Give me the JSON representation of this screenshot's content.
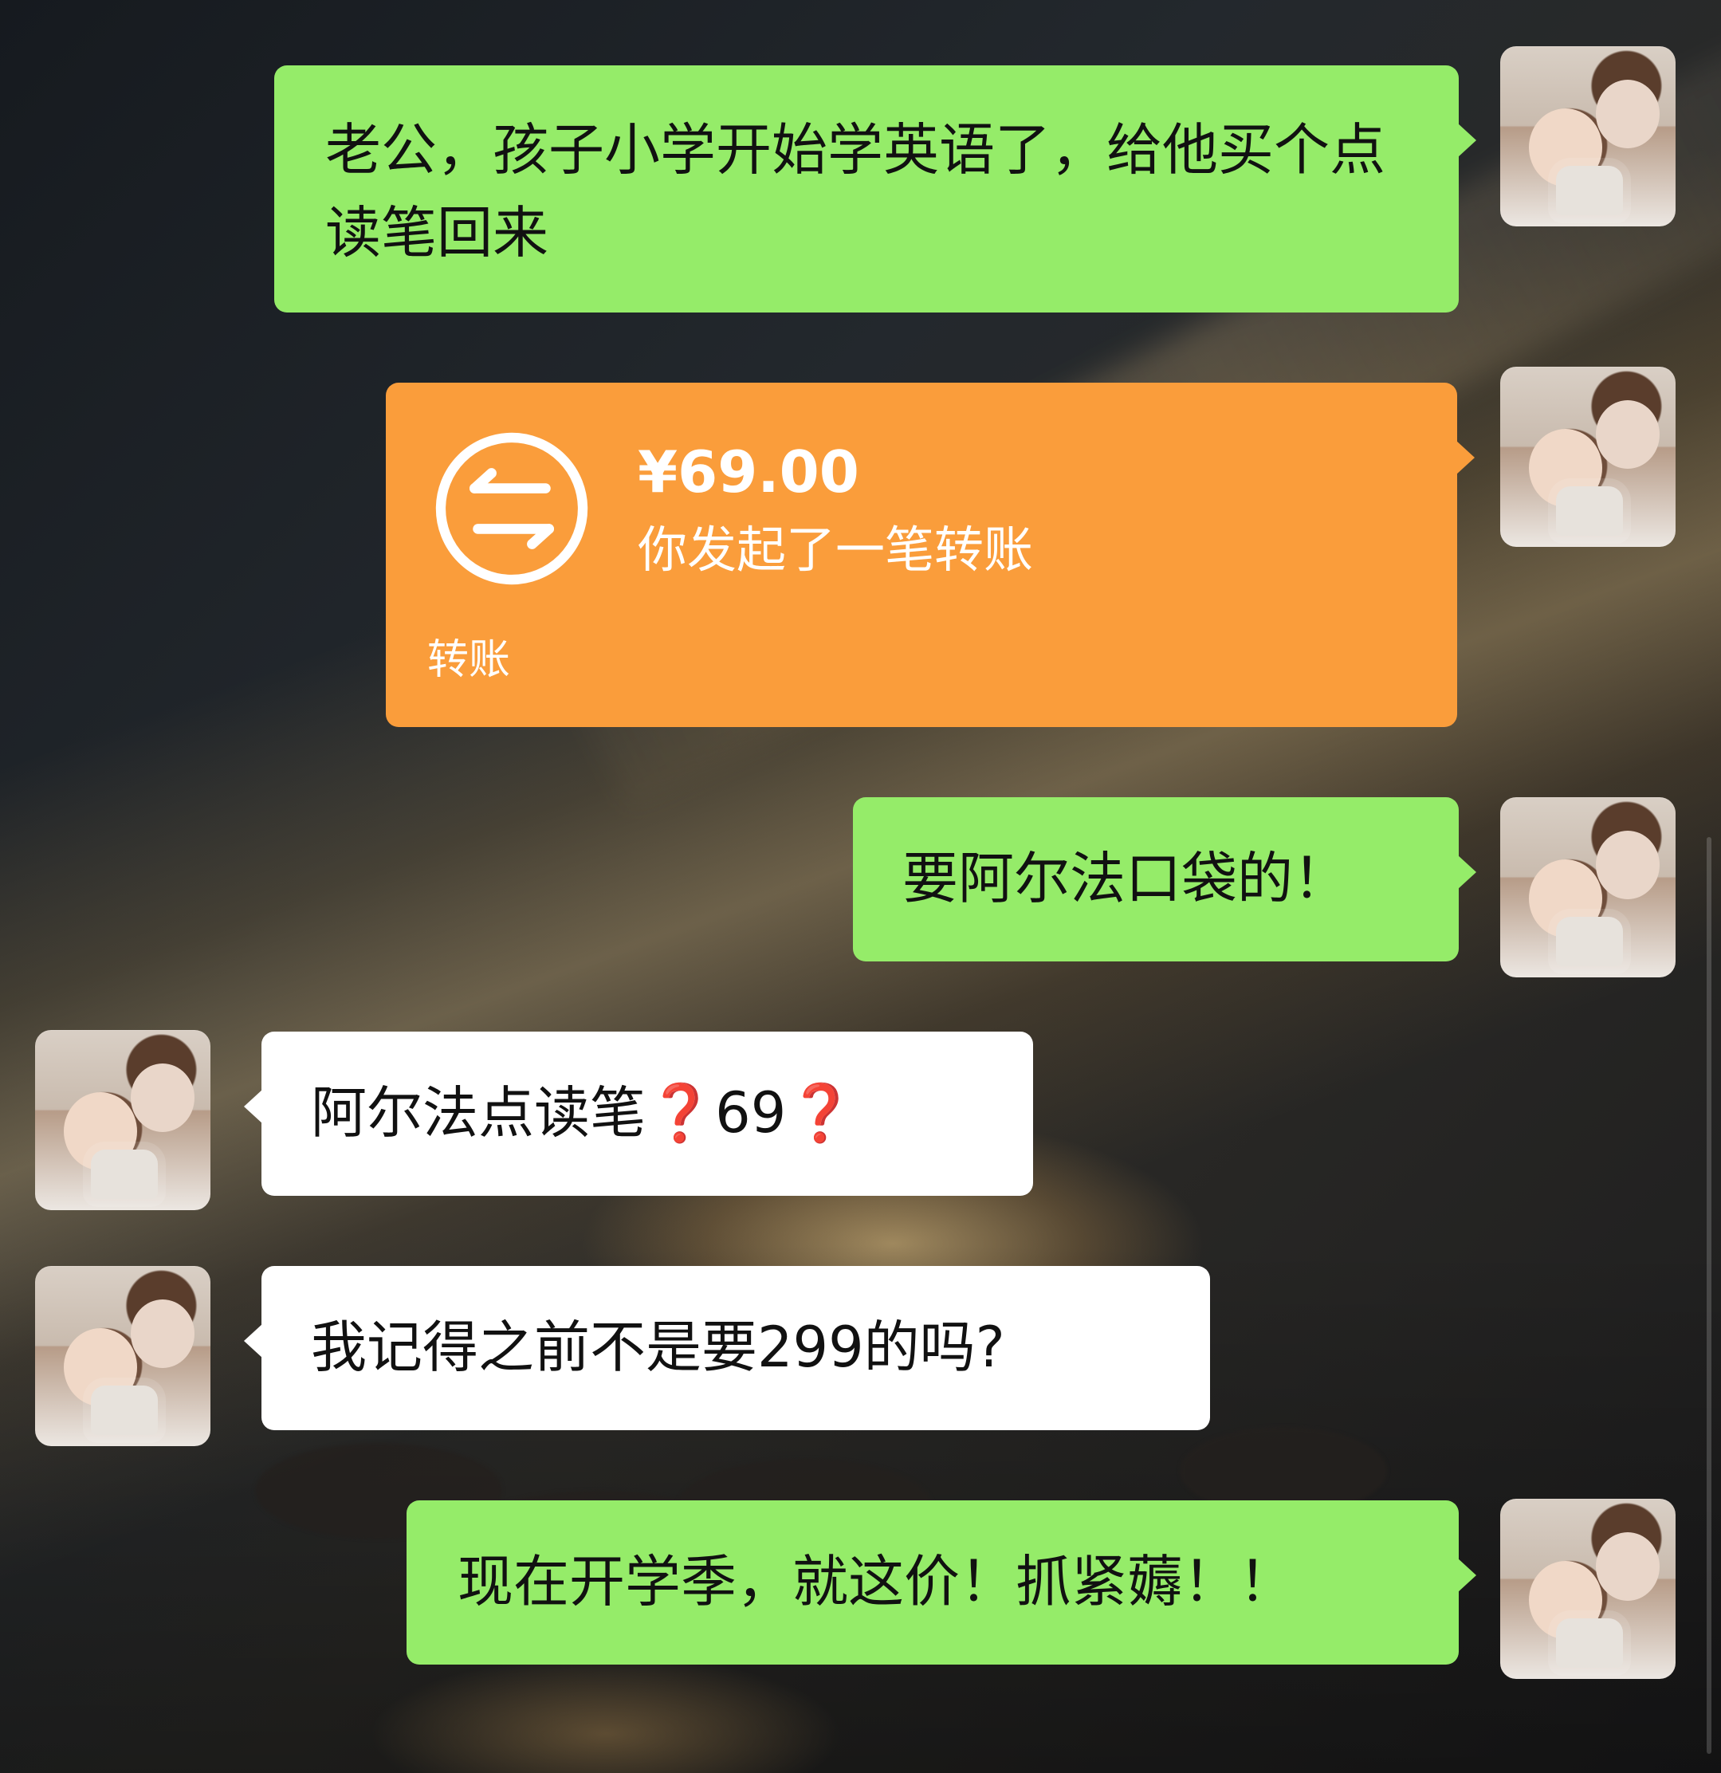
{
  "messages": [
    {
      "id": "m1",
      "side": "right",
      "type": "text",
      "text": "老公，孩子小学开始学英语了，给他买个点读笔回来"
    },
    {
      "id": "m2",
      "side": "right",
      "type": "transfer",
      "amount": "¥69.00",
      "description": "你发起了一笔转账",
      "footer": "转账"
    },
    {
      "id": "m3",
      "side": "right",
      "type": "text",
      "text": "要阿尔法口袋的！"
    },
    {
      "id": "m4",
      "side": "left",
      "type": "text_question",
      "text_before": "阿尔法点读笔",
      "mark1": "❓",
      "text_middle": "69",
      "mark2": "❓"
    },
    {
      "id": "m5",
      "side": "left",
      "type": "text",
      "text": "我记得之前不是要299的吗?"
    },
    {
      "id": "m6",
      "side": "right",
      "type": "text",
      "text": "现在开学季，就这价！抓紧薅！！"
    }
  ],
  "colors": {
    "green_bubble": "#95ec69",
    "white_bubble": "#ffffff",
    "orange_bubble": "#fa9d3b",
    "question_red": "#d3142b"
  },
  "icons": {
    "transfer": "transfer-icon"
  }
}
